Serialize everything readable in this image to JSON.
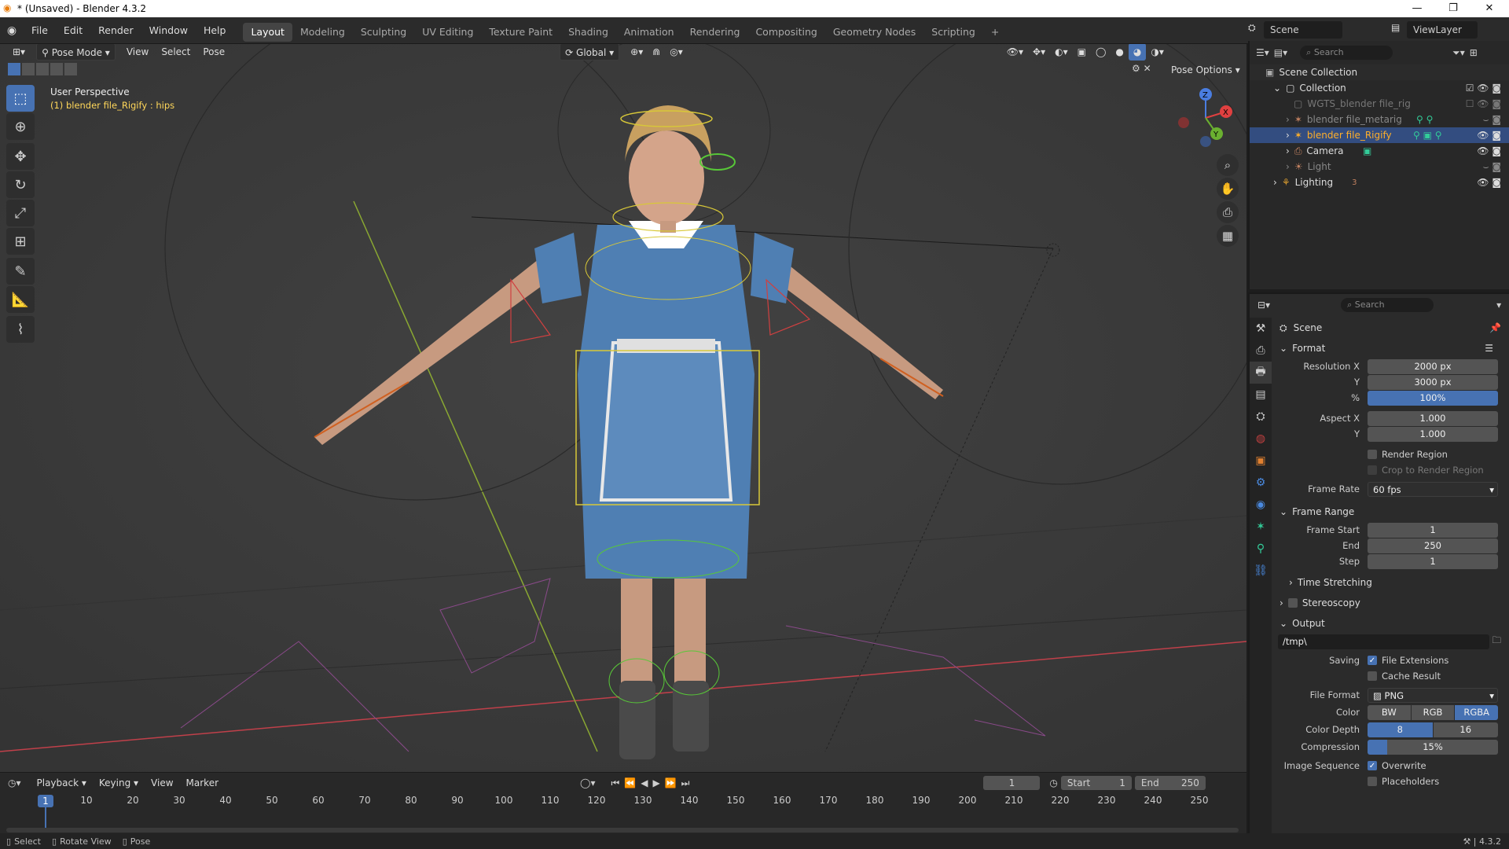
{
  "window": {
    "title": "* (Unsaved) - Blender 4.3.2"
  },
  "menubar": {
    "menus": [
      "File",
      "Edit",
      "Render",
      "Window",
      "Help"
    ],
    "workspaces": [
      "Layout",
      "Modeling",
      "Sculpting",
      "UV Editing",
      "Texture Paint",
      "Shading",
      "Animation",
      "Rendering",
      "Compositing",
      "Geometry Nodes",
      "Scripting"
    ],
    "active_workspace": "Layout",
    "add_tab": "+",
    "scene_label": "Scene",
    "viewlayer_label": "ViewLayer"
  },
  "viewport": {
    "mode": "Pose Mode",
    "menus": [
      "View",
      "Select",
      "Pose"
    ],
    "orientation": "Global",
    "pose_options": "Pose Options",
    "perspective": "User Perspective",
    "active_object": "(1) blender file_Rigify : hips",
    "gizmo_axes": {
      "z": "Z",
      "x": "X",
      "y": "Y"
    }
  },
  "outliner": {
    "search_placeholder": "Search",
    "root": "Scene Collection",
    "items": [
      {
        "label": "Collection"
      },
      {
        "label": "WGTS_blender file_rig"
      },
      {
        "label": "blender file_metarig"
      },
      {
        "label": "blender file_Rigify"
      },
      {
        "label": "Camera"
      },
      {
        "label": "Light"
      },
      {
        "label": "Lighting",
        "count": "3"
      }
    ]
  },
  "properties": {
    "search_placeholder": "Search",
    "context": "Scene",
    "format": {
      "title": "Format",
      "res_x_label": "Resolution X",
      "res_x": "2000 px",
      "res_y_label": "Y",
      "res_y": "3000 px",
      "pct_label": "%",
      "pct": "100%",
      "aspect_x_label": "Aspect X",
      "aspect_x": "1.000",
      "aspect_y_label": "Y",
      "aspect_y": "1.000",
      "render_region": "Render Region",
      "crop_region": "Crop to Render Region",
      "frame_rate_label": "Frame Rate",
      "frame_rate": "60 fps"
    },
    "frame_range": {
      "title": "Frame Range",
      "start_label": "Frame Start",
      "start": "1",
      "end_label": "End",
      "end": "250",
      "step_label": "Step",
      "step": "1"
    },
    "time_stretching": "Time Stretching",
    "stereoscopy": "Stereoscopy",
    "output": {
      "title": "Output",
      "path": "/tmp\\",
      "saving_label": "Saving",
      "file_extensions": "File Extensions",
      "cache_result": "Cache Result",
      "file_format_label": "File Format",
      "file_format": "PNG",
      "color_label": "Color",
      "color_options": [
        "BW",
        "RGB",
        "RGBA"
      ],
      "color_selected": "RGBA",
      "depth_label": "Color Depth",
      "depth_options": [
        "8",
        "16"
      ],
      "depth_selected": "8",
      "compression_label": "Compression",
      "compression": "15%",
      "image_sequence_label": "Image Sequence",
      "overwrite": "Overwrite",
      "placeholders": "Placeholders"
    }
  },
  "timeline": {
    "menus": [
      "Playback",
      "Keying",
      "View",
      "Marker"
    ],
    "current_frame": "1",
    "start_label": "Start",
    "start": "1",
    "end_label": "End",
    "end": "250",
    "ticks": [
      "1",
      "10",
      "20",
      "30",
      "40",
      "50",
      "60",
      "70",
      "80",
      "90",
      "100",
      "110",
      "120",
      "130",
      "140",
      "150",
      "160",
      "170",
      "180",
      "190",
      "200",
      "210",
      "220",
      "230",
      "240",
      "250"
    ]
  },
  "statusbar": {
    "select": "Select",
    "rotate": "Rotate View",
    "pose": "Pose",
    "version": "4.3.2"
  },
  "colors": {
    "accent": "#4772b3",
    "selected_obj": "#ffaf29",
    "viewport_bg": "#3d3d3d"
  }
}
